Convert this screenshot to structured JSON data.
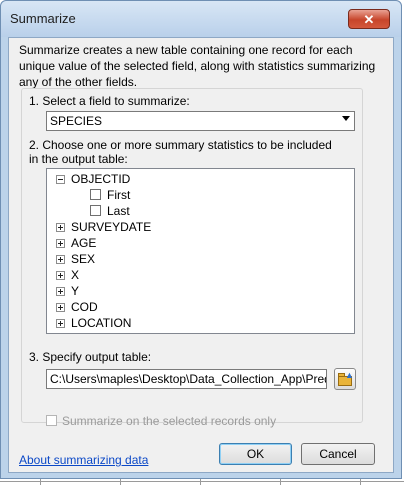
{
  "window": {
    "title": "Summarize",
    "close_glyph": "✕"
  },
  "intro_text": "Summarize creates a new table containing one record for each unique value of the selected field, along with statistics summarizing any of the other fields.",
  "step1": {
    "label": "1.  Select a field to summarize:",
    "selected_field": "SPECIES"
  },
  "step2": {
    "label": "2.  Choose one or more summary statistics to be included in the output table:",
    "tree": [
      {
        "name": "OBJECTID",
        "expanded": true,
        "children": [
          {
            "name": "First",
            "checked": false
          },
          {
            "name": "Last",
            "checked": false
          }
        ]
      },
      {
        "name": "SURVEYDATE",
        "expanded": false
      },
      {
        "name": "AGE",
        "expanded": false
      },
      {
        "name": "SEX",
        "expanded": false
      },
      {
        "name": "X",
        "expanded": false
      },
      {
        "name": "Y",
        "expanded": false
      },
      {
        "name": "COD",
        "expanded": false
      },
      {
        "name": "LOCATION",
        "expanded": false
      }
    ]
  },
  "step3": {
    "label": "3.  Specify output table:",
    "output_path": "C:\\Users\\maples\\Desktop\\Data_Collection_App\\Predatio",
    "browse_icon": "open-folder-icon"
  },
  "selected_only": {
    "label": "Summarize on the selected records only",
    "checked": false,
    "enabled": false
  },
  "buttons": {
    "ok": "OK",
    "cancel": "Cancel"
  },
  "about_link": "About summarizing data"
}
